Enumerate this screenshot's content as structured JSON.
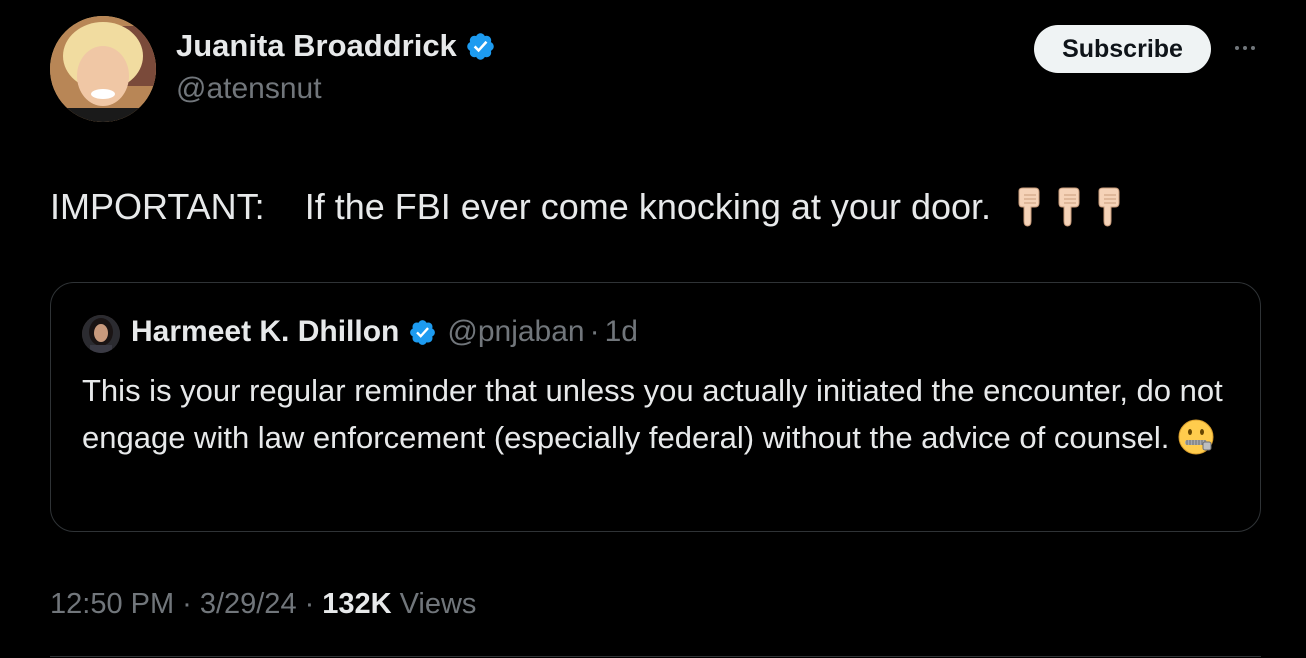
{
  "author": {
    "name": "Juanita Broaddrick",
    "handle": "@atensnut",
    "verified": true
  },
  "actions": {
    "subscribe_label": "Subscribe",
    "more_icon": "more-horizontal-icon"
  },
  "tweet": {
    "text": "IMPORTANT:    If the FBI ever come knocking at your door.",
    "emojis": [
      "backhand-index-pointing-down",
      "backhand-index-pointing-down",
      "backhand-index-pointing-down"
    ]
  },
  "quote": {
    "name": "Harmeet K. Dhillon",
    "handle": "@pnjaban",
    "separator": "·",
    "time": "1d",
    "verified": true,
    "text": "This is your regular reminder that unless you actually initiated the encounter, do not engage with law enforcement (especially federal) without the advice of counsel.",
    "emoji": "zipper-mouth-face"
  },
  "meta": {
    "time": "12:50 PM",
    "date": "3/29/24",
    "separator": "·",
    "views_count": "132K",
    "views_label": "Views"
  },
  "colors": {
    "background": "#000000",
    "text": "#e7e9ea",
    "secondary": "#71767b",
    "verified": "#1d9bf0",
    "border": "#2f3336"
  }
}
